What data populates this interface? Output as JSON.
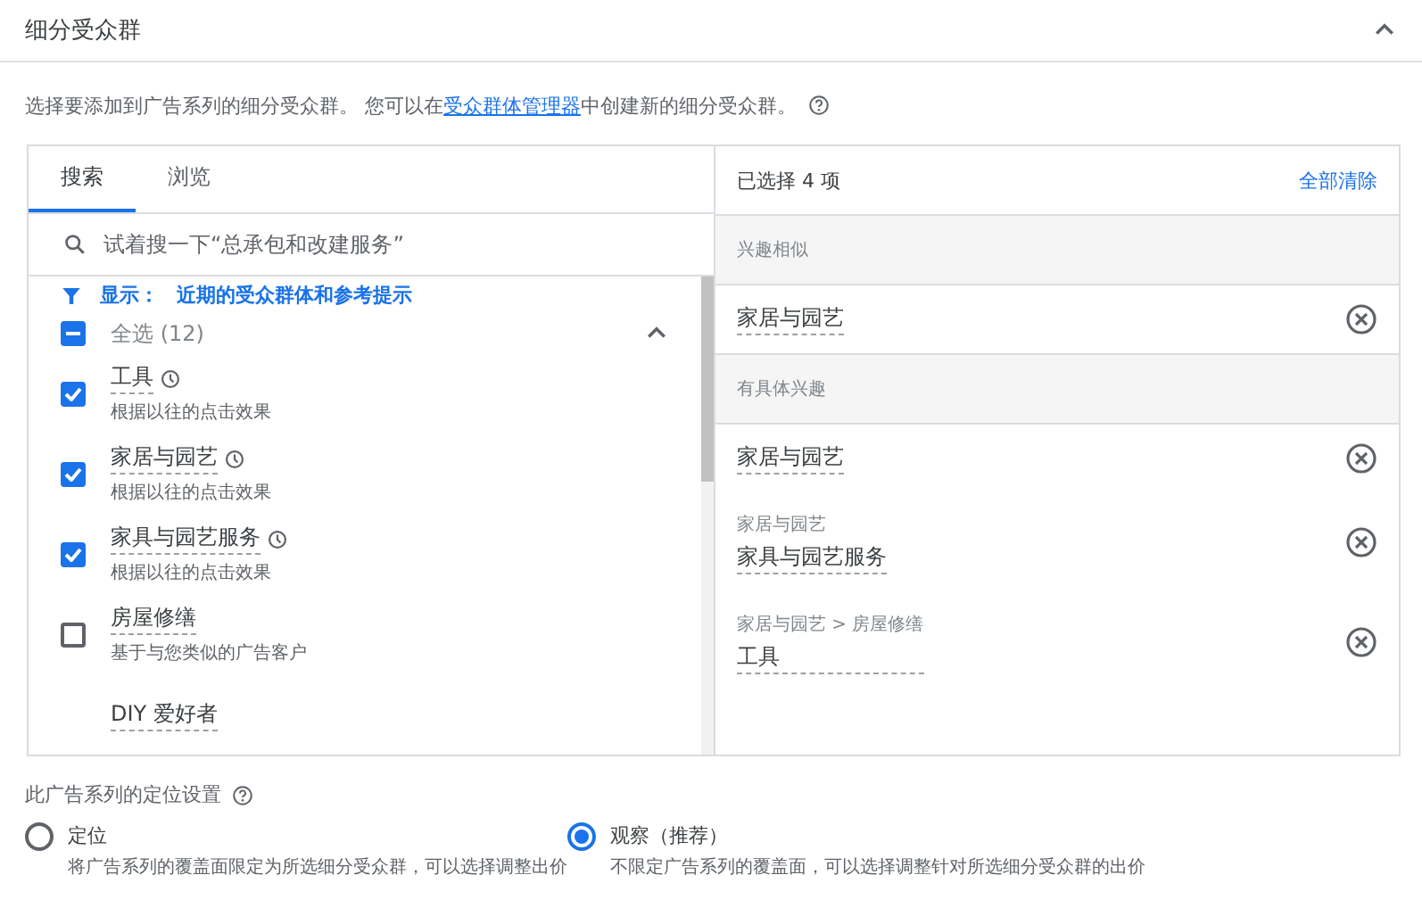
{
  "section": {
    "title": "细分受众群",
    "expanded": true
  },
  "description": {
    "before": "选择要添加到广告系列的细分受众群。 您可以在",
    "link": "受众群体管理器",
    "after": "中创建新的细分受众群。"
  },
  "browser": {
    "tabs": [
      {
        "label": "搜索",
        "selected": true
      },
      {
        "label": "浏览",
        "selected": false
      }
    ],
    "search": {
      "placeholder": "试着搜一下“总承包和改建服务”"
    },
    "filter": {
      "label": "显示：",
      "value": "近期的受众群体和参考提示"
    },
    "select_all": {
      "label": "全选 (12)",
      "indeterminate": true,
      "expanded": true
    },
    "items": [
      {
        "name": "工具",
        "recent": true,
        "note": "根据以往的点击效果",
        "checked": true
      },
      {
        "name": "家居与园艺",
        "recent": true,
        "note": "根据以往的点击效果",
        "checked": true
      },
      {
        "name": "家具与园艺服务",
        "recent": true,
        "note": "根据以往的点击效果",
        "checked": true
      },
      {
        "name": "房屋修缮",
        "recent": false,
        "note": "基于与您类似的广告客户",
        "checked": false
      },
      {
        "name": "DIY 爱好者",
        "recent": false
      }
    ]
  },
  "selected": {
    "title": "已选择 4 项",
    "clear": "全部清除",
    "groups": [
      {
        "title": "兴趣相似",
        "items": [
          {
            "name": "家居与园艺"
          }
        ]
      },
      {
        "title": "有具体兴趣",
        "items": [
          {
            "name": "家居与园艺"
          },
          {
            "path": "家居与园艺",
            "name": "家具与园艺服务"
          },
          {
            "path": "家居与园艺 > 房屋修缮",
            "name": "工具"
          }
        ]
      }
    ]
  },
  "targeting": {
    "title": "此广告系列的定位设置",
    "options": [
      {
        "label": "定位",
        "description": "将广告系列的覆盖面限定为所选细分受众群，可以选择调整出价",
        "selected": false
      },
      {
        "label": "观察（推荐）",
        "description": "不限定广告系列的覆盖面，可以选择调整针对所选细分受众群的出价",
        "selected": true
      }
    ]
  }
}
